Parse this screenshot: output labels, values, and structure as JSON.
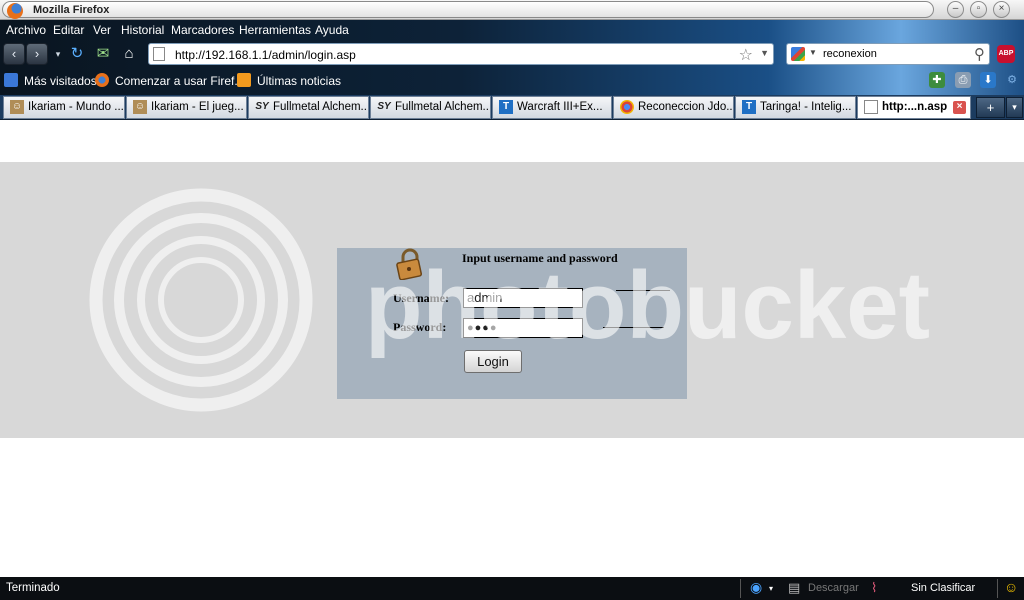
{
  "window": {
    "title": "Mozilla Firefox"
  },
  "menu": [
    "Archivo",
    "Editar",
    "Ver",
    "Historial",
    "Marcadores",
    "Herramientas",
    "Ayuda"
  ],
  "nav": {
    "url": "http://192.168.1.1/admin/login.asp",
    "search_value": "reconexion"
  },
  "bookmarks": [
    {
      "label": "Más visitados",
      "icon": "most-visited-icon"
    },
    {
      "label": "Comenzar a usar Firef...",
      "icon": "firefox-icon"
    },
    {
      "label": "Últimas noticias",
      "icon": "rss-icon"
    }
  ],
  "tabs": [
    {
      "label": "Ikariam - Mundo ...",
      "icon": "ikariam-icon",
      "active": false
    },
    {
      "label": "Ikariam - El jueg...",
      "icon": "ikariam-icon",
      "active": false
    },
    {
      "label": "Fullmetal Alchem...",
      "icon": "sy-icon",
      "active": false
    },
    {
      "label": "Fullmetal Alchem...",
      "icon": "sy-icon",
      "active": false
    },
    {
      "label": "Warcraft III+Ex...",
      "icon": "taringa-icon",
      "active": false
    },
    {
      "label": "Reconeccion Jdo...",
      "icon": "chrome-icon",
      "active": false
    },
    {
      "label": "Taringa! - Intelig...",
      "icon": "taringa-icon",
      "active": false
    },
    {
      "label": "http:...n.asp",
      "icon": "page-icon",
      "active": true
    }
  ],
  "login": {
    "heading": "Input username and password",
    "username_label": "Username:",
    "username_value": "admin",
    "password_label": "Password:",
    "password_value": "●●●●",
    "button_label": "Login"
  },
  "watermark": {
    "text": "photobucket"
  },
  "status": {
    "text": "Terminado",
    "download_label": "Descargar",
    "classification": "Sin Clasificar"
  },
  "colors": {
    "page_gray_band": "#d8d8d8",
    "login_box": "#a7b3bf",
    "chrome_dark": "#0d2238"
  }
}
